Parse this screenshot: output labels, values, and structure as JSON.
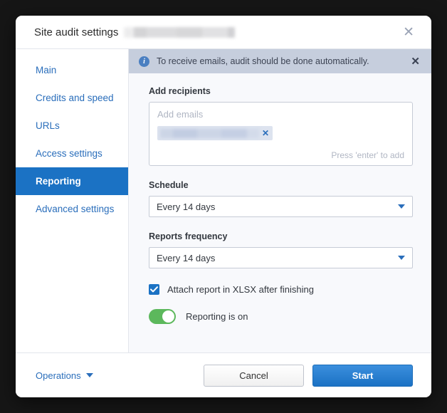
{
  "window": {
    "title": "Site audit settings",
    "title_redacted": true,
    "close_icon": "✕"
  },
  "sidebar": {
    "items": [
      {
        "label": "Main",
        "active": false
      },
      {
        "label": "Credits and speed",
        "active": false
      },
      {
        "label": "URLs",
        "active": false
      },
      {
        "label": "Access settings",
        "active": false
      },
      {
        "label": "Reporting",
        "active": true
      },
      {
        "label": "Advanced settings",
        "active": false
      }
    ]
  },
  "banner": {
    "icon": "i",
    "text": "To receive emails, audit should be done automatically.",
    "close_icon": "✕"
  },
  "form": {
    "recipients": {
      "label": "Add recipients",
      "placeholder": "Add emails",
      "hint": "Press 'enter' to add",
      "chips": [
        {
          "value_redacted": true,
          "remove_icon": "✕"
        }
      ]
    },
    "schedule": {
      "label": "Schedule",
      "value": "Every 14 days"
    },
    "reports_frequency": {
      "label": "Reports frequency",
      "value": "Every 14 days"
    },
    "attach_xlsx": {
      "label": "Attach report in XLSX after finishing",
      "checked": true
    },
    "reporting_toggle": {
      "label": "Reporting is on",
      "on": true
    }
  },
  "footer": {
    "operations_label": "Operations",
    "cancel_label": "Cancel",
    "start_label": "Start"
  },
  "colors": {
    "accent_blue": "#1b72c4",
    "link_blue": "#2a6ebb",
    "toggle_green": "#5cb85c",
    "banner_bg": "#c6cedd",
    "content_bg": "#f8f9fc"
  }
}
